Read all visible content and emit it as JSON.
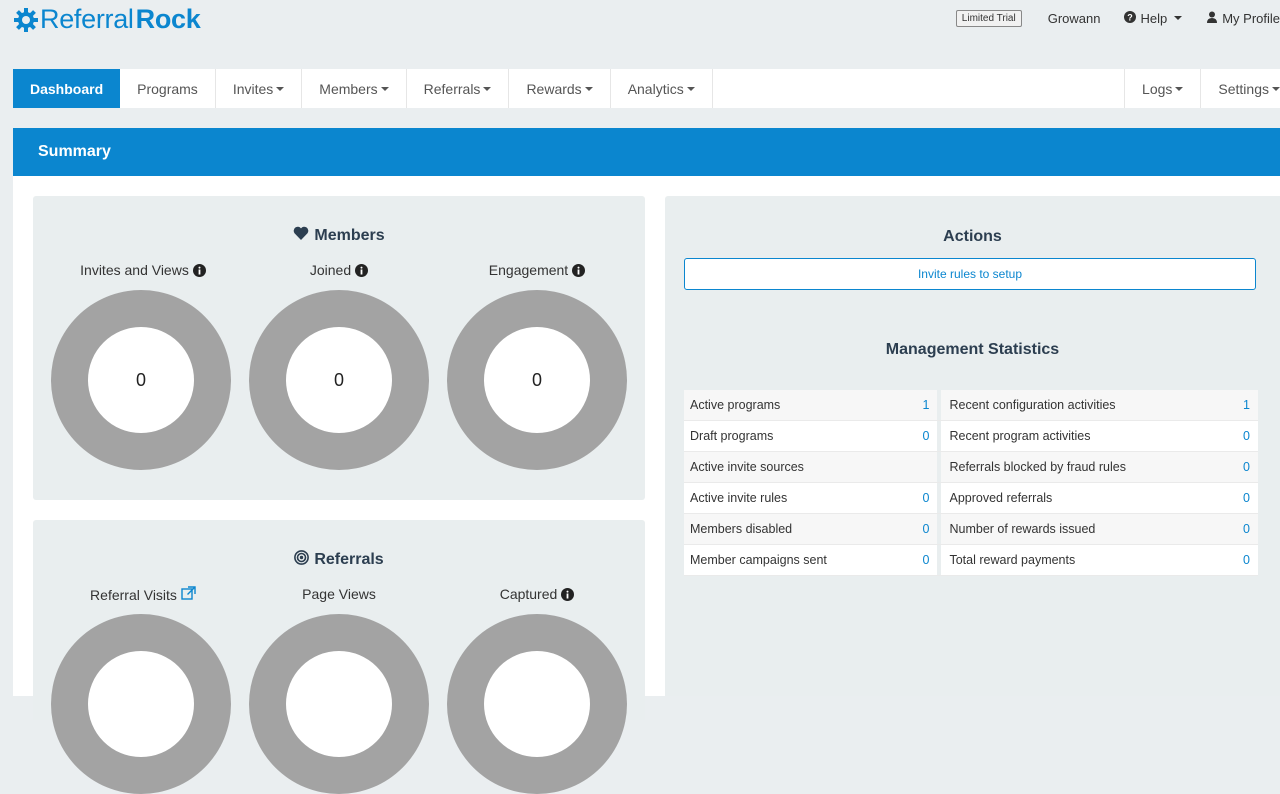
{
  "brand": {
    "part1": "Referral",
    "part2": "Rock"
  },
  "topbar": {
    "trial_badge": "Limited Trial",
    "account": "Growann",
    "help": "Help",
    "profile": "My Profile"
  },
  "nav": {
    "dashboard": "Dashboard",
    "programs": "Programs",
    "invites": "Invites",
    "members": "Members",
    "referrals": "Referrals",
    "rewards": "Rewards",
    "analytics": "Analytics",
    "logs": "Logs",
    "settings": "Settings"
  },
  "summary": {
    "title": "Summary"
  },
  "members_panel": {
    "title": "Members",
    "metrics": [
      {
        "label": "Invites and Views",
        "value": "0"
      },
      {
        "label": "Joined",
        "value": "0"
      },
      {
        "label": "Engagement",
        "value": "0"
      }
    ]
  },
  "referrals_panel": {
    "title": "Referrals",
    "metrics": [
      {
        "label": "Referral Visits"
      },
      {
        "label": "Page Views"
      },
      {
        "label": "Captured"
      }
    ]
  },
  "actions": {
    "title": "Actions",
    "button": "Invite rules to setup"
  },
  "stats": {
    "title": "Management Statistics",
    "rows": [
      {
        "left_label": "Active programs",
        "left_value": "1",
        "right_label": "Recent configuration activities",
        "right_value": "1"
      },
      {
        "left_label": "Draft programs",
        "left_value": "0",
        "right_label": "Recent program activities",
        "right_value": "0"
      },
      {
        "left_label": "Active invite sources",
        "left_value": "",
        "right_label": "Referrals blocked by fraud rules",
        "right_value": "0"
      },
      {
        "left_label": "Active invite rules",
        "left_value": "0",
        "right_label": "Approved referrals",
        "right_value": "0"
      },
      {
        "left_label": "Members disabled",
        "left_value": "0",
        "right_label": "Number of rewards issued",
        "right_value": "0"
      },
      {
        "left_label": "Member campaigns sent",
        "left_value": "0",
        "right_label": "Total reward payments",
        "right_value": "0"
      }
    ]
  },
  "colors": {
    "accent": "#0b86cf",
    "donut": "#a3a3a3",
    "panel": "#e9eeef"
  },
  "icons": {
    "logo": "gear-icon",
    "help": "question-circle-icon",
    "profile": "user-icon",
    "members": "heart-icon",
    "referrals": "bullseye-icon",
    "info": "info-circle-icon",
    "external": "external-link-icon"
  }
}
